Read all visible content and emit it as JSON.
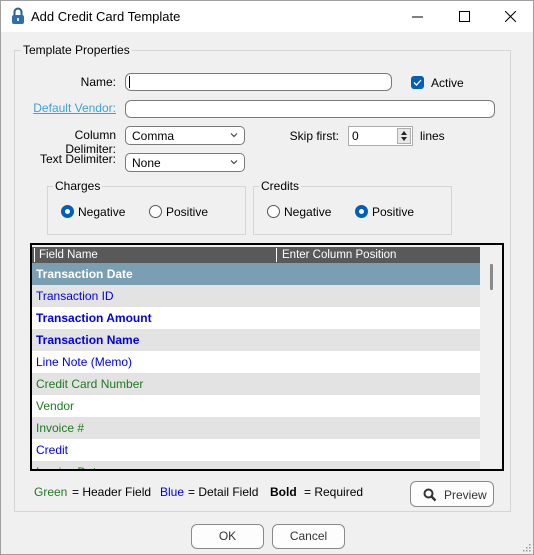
{
  "window": {
    "title": "Add Credit Card Template",
    "icon": "padlock-icon",
    "controls": [
      "minimize-icon",
      "maximize-icon",
      "close-icon"
    ]
  },
  "template_properties": {
    "group_label": "Template Properties",
    "name_label": "Name:",
    "name_value": "",
    "active_label": "Active",
    "active_checked": true,
    "default_vendor_label": "Default Vendor:",
    "default_vendor_value": "",
    "column_delimiter_label": "Column Delimiter:",
    "column_delimiter_value": "Comma",
    "text_delimiter_label": "Text Delimiter:",
    "text_delimiter_value": "None",
    "skip_first_label": "Skip first:",
    "skip_first_value": "0",
    "lines_label": "lines"
  },
  "charges": {
    "group_label": "Charges",
    "options": [
      "Negative",
      "Positive"
    ],
    "selected": "Negative"
  },
  "credits": {
    "group_label": "Credits",
    "options": [
      "Negative",
      "Positive"
    ],
    "selected": "Positive"
  },
  "grid": {
    "columns": [
      "Field Name",
      "Enter Column Position"
    ],
    "rows": [
      {
        "name": "Transaction Date",
        "type": "detail",
        "required": true,
        "selected": true,
        "position": ""
      },
      {
        "name": "Transaction ID",
        "type": "detail",
        "required": false,
        "selected": false,
        "position": ""
      },
      {
        "name": "Transaction Amount",
        "type": "detail",
        "required": true,
        "selected": false,
        "position": ""
      },
      {
        "name": "Transaction Name",
        "type": "detail",
        "required": true,
        "selected": false,
        "position": ""
      },
      {
        "name": "Line Note (Memo)",
        "type": "detail",
        "required": false,
        "selected": false,
        "position": ""
      },
      {
        "name": "Credit Card Number",
        "type": "header",
        "required": false,
        "selected": false,
        "position": ""
      },
      {
        "name": "Vendor",
        "type": "header",
        "required": false,
        "selected": false,
        "position": ""
      },
      {
        "name": "Invoice #",
        "type": "header",
        "required": false,
        "selected": false,
        "position": ""
      },
      {
        "name": "Credit",
        "type": "detail",
        "required": false,
        "selected": false,
        "position": ""
      },
      {
        "name": "Invoice Date",
        "type": "header",
        "required": false,
        "selected": false,
        "position": ""
      }
    ]
  },
  "legend": {
    "green_word": "Green",
    "green_desc": "= Header Field",
    "blue_word": "Blue",
    "blue_desc": "= Detail Field",
    "bold_word": "Bold",
    "bold_desc": "= Required"
  },
  "colors": {
    "header_field": "#1e7b1e",
    "detail_field": "#0000e6",
    "selected_row": "#7a9fb3",
    "accent": "#005fb8",
    "link": "#3aa4d8"
  },
  "buttons": {
    "preview": "Preview",
    "ok": "OK",
    "cancel": "Cancel"
  }
}
